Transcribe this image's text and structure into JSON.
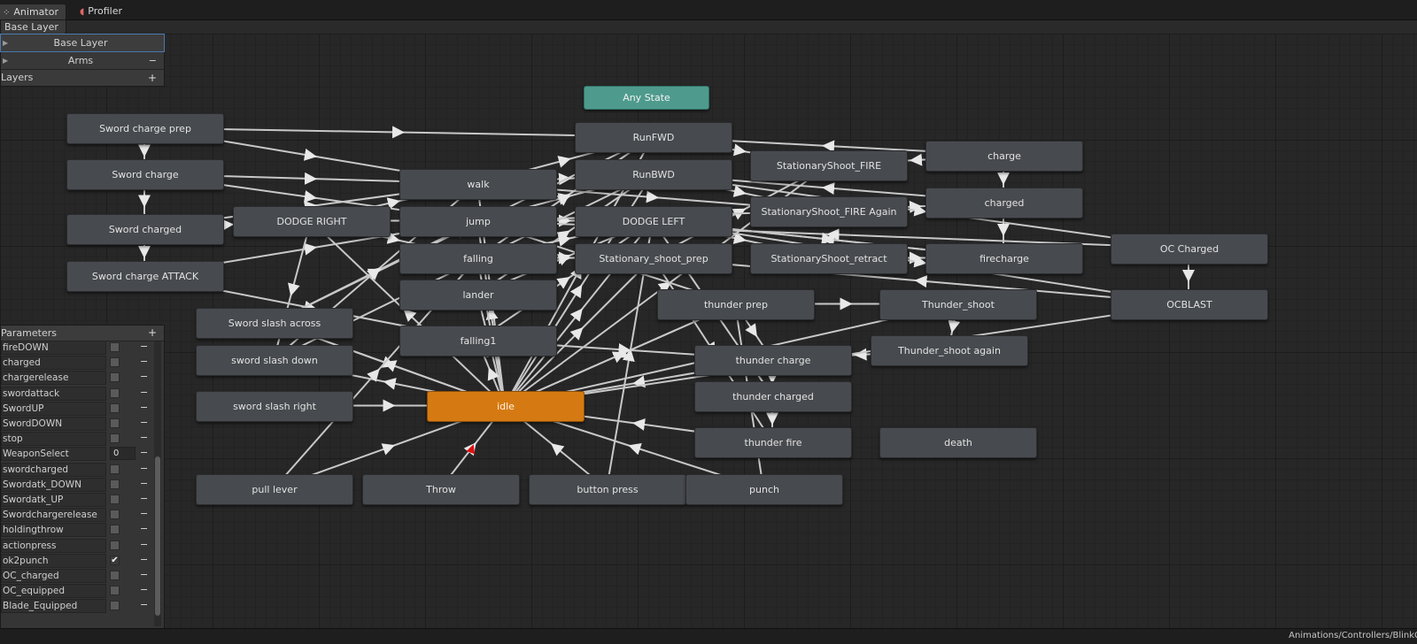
{
  "tabs": [
    {
      "label": "Animator",
      "icon": "animator-icon"
    },
    {
      "label": "Profiler",
      "icon": "profiler-icon"
    }
  ],
  "breadcrumb": "Base Layer",
  "layers": {
    "header": "Layers",
    "items": [
      {
        "name": "Base Layer"
      },
      {
        "name": "Arms"
      }
    ]
  },
  "states": {
    "any_state": "Any State",
    "sword_charge_prep": "Sword charge prep",
    "sword_charge": "Sword charge",
    "sword_charged": "Sword charged",
    "sword_charge_attack": "Sword charge ATTACK",
    "dodge_right": "DODGE RIGHT",
    "walk": "walk",
    "jump": "jump",
    "falling": "falling",
    "lander": "lander",
    "falling1": "falling1",
    "runfwd": "RunFWD",
    "runbwd": "RunBWD",
    "dodge_left": "DODGE LEFT",
    "stationary_shoot_prep": "Stationary_shoot_prep",
    "stationary_shoot_fire": "StationaryShoot_FIRE",
    "stationary_shoot_fire_again": "StationaryShoot_FIRE Again",
    "stationary_shoot_retract": "StationaryShoot_retract",
    "charge": "charge",
    "charged": "charged",
    "firecharge": "firecharge",
    "oc_charged": "OC Charged",
    "ocblast": "OCBLAST",
    "thunder_prep": "thunder prep",
    "thunder_shoot": "Thunder_shoot",
    "thunder_shoot_again": "Thunder_shoot again",
    "thunder_charge": "thunder charge",
    "thunder_charged": "thunder charged",
    "thunder_fire": "thunder fire",
    "death": "death",
    "sword_slash_across": "Sword slash across",
    "sword_slash_down": "sword slash down",
    "sword_slash_right": "sword slash right",
    "idle": "idle",
    "pull_lever": "pull lever",
    "throw": "Throw",
    "button_press": "button press",
    "punch": "punch"
  },
  "parameters": {
    "header": "Parameters",
    "items": [
      {
        "name": "fireDOWN",
        "type": "bool",
        "value": false
      },
      {
        "name": "charged",
        "type": "bool",
        "value": false
      },
      {
        "name": "chargerelease",
        "type": "bool",
        "value": false
      },
      {
        "name": "swordattack",
        "type": "bool",
        "value": false
      },
      {
        "name": "SwordUP",
        "type": "bool",
        "value": false
      },
      {
        "name": "SwordDOWN",
        "type": "bool",
        "value": false
      },
      {
        "name": "stop",
        "type": "bool",
        "value": false
      },
      {
        "name": "WeaponSelect",
        "type": "int",
        "value": "0"
      },
      {
        "name": "swordcharged",
        "type": "bool",
        "value": false
      },
      {
        "name": "Swordatk_DOWN",
        "type": "bool",
        "value": false
      },
      {
        "name": "Swordatk_UP",
        "type": "bool",
        "value": false
      },
      {
        "name": "Swordchargerelease",
        "type": "bool",
        "value": false
      },
      {
        "name": "holdingthrow",
        "type": "bool",
        "value": false
      },
      {
        "name": "actionpress",
        "type": "bool",
        "value": false
      },
      {
        "name": "ok2punch",
        "type": "bool",
        "value": true
      },
      {
        "name": "OC_charged",
        "type": "bool",
        "value": false
      },
      {
        "name": "OC_equipped",
        "type": "bool",
        "value": false
      },
      {
        "name": "Blade_Equipped",
        "type": "bool",
        "value": false
      }
    ]
  },
  "status_path": "Animations/Controllers/BlinkC",
  "colors": {
    "any_state": "#4e9b8d",
    "default_state": "#d57a12",
    "state": "#474a4e",
    "transition": "#d0d0d0"
  }
}
